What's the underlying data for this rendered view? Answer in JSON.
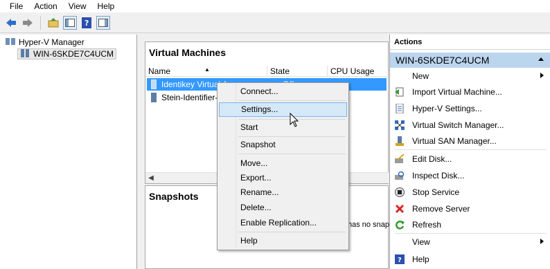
{
  "menubar": {
    "items": [
      "File",
      "Action",
      "View",
      "Help"
    ]
  },
  "toolbar": {
    "icons": [
      "back-arrow-icon",
      "forward-arrow-icon",
      "up-folder-icon",
      "show-hide-tree-icon",
      "help-icon",
      "show-hide-action-pane-icon"
    ]
  },
  "tree": {
    "root": "Hyper-V Manager",
    "server": "WIN-6SKDE7C4UCM"
  },
  "vm_panel": {
    "title": "Virtual Machines",
    "columns": [
      "Name",
      "State",
      "CPU Usage"
    ],
    "rows": [
      {
        "name": "Identikey Virtual A",
        "state": "Off",
        "selected": true
      },
      {
        "name": "Stein-Identifier-3.5",
        "state": "",
        "selected": false
      }
    ]
  },
  "snapshots_panel": {
    "title": "Snapshots",
    "empty_text": "has no snap"
  },
  "context_menu": {
    "items": [
      {
        "label": "Connect...",
        "highlighted": false
      },
      {
        "label": "Settings...",
        "highlighted": true
      },
      {
        "label": "Start",
        "highlighted": false
      },
      {
        "label": "Snapshot",
        "highlighted": false
      },
      {
        "label": "Move...",
        "highlighted": false
      },
      {
        "label": "Export...",
        "highlighted": false
      },
      {
        "label": "Rename...",
        "highlighted": false
      },
      {
        "label": "Delete...",
        "highlighted": false
      },
      {
        "label": "Enable Replication...",
        "highlighted": false
      },
      {
        "label": "Help",
        "highlighted": false
      }
    ]
  },
  "actions": {
    "header": "Actions",
    "section": "WIN-6SKDE7C4UCM",
    "items": [
      {
        "label": "New",
        "icon": "none",
        "submenu": true
      },
      {
        "label": "Import Virtual Machine...",
        "icon": "import-icon"
      },
      {
        "label": "Hyper-V Settings...",
        "icon": "settings-document-icon"
      },
      {
        "label": "Virtual Switch Manager...",
        "icon": "switch-icon"
      },
      {
        "label": "Virtual SAN Manager...",
        "icon": "san-icon"
      },
      {
        "label": "Edit Disk...",
        "icon": "edit-disk-icon"
      },
      {
        "label": "Inspect Disk...",
        "icon": "inspect-disk-icon"
      },
      {
        "label": "Stop Service",
        "icon": "stop-icon"
      },
      {
        "label": "Remove Server",
        "icon": "remove-x-icon"
      },
      {
        "label": "Refresh",
        "icon": "refresh-icon"
      },
      {
        "label": "View",
        "icon": "none",
        "submenu": true
      },
      {
        "label": "Help",
        "icon": "help-icon"
      }
    ]
  },
  "colors": {
    "selection": "#3399ff",
    "section_header": "#bcd5ee",
    "menu_highlight": "#d5e8f7"
  }
}
